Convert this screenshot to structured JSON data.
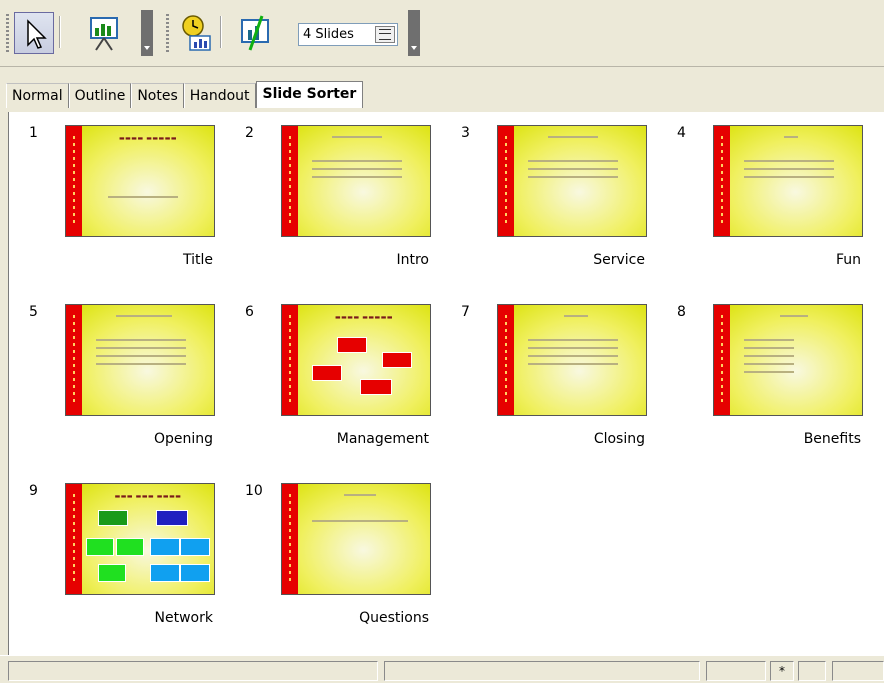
{
  "toolbar": {
    "buttons": [
      {
        "name": "select-arrow-icon"
      },
      {
        "name": "slide-show-icon"
      },
      {
        "name": "rehearse-timings-icon"
      },
      {
        "name": "show-hide-slide-icon"
      }
    ],
    "slides_per_row_value": "4 Slides"
  },
  "tabs": [
    {
      "label": "Normal"
    },
    {
      "label": "Outline"
    },
    {
      "label": "Notes"
    },
    {
      "label": "Handout"
    },
    {
      "label": "Slide Sorter",
      "selected": true
    }
  ],
  "slides": [
    {
      "number": "1",
      "name": "Title"
    },
    {
      "number": "2",
      "name": "Intro"
    },
    {
      "number": "3",
      "name": "Service"
    },
    {
      "number": "4",
      "name": "Fun"
    },
    {
      "number": "5",
      "name": "Opening"
    },
    {
      "number": "6",
      "name": "Management"
    },
    {
      "number": "7",
      "name": "Closing"
    },
    {
      "number": "8",
      "name": "Benefits"
    },
    {
      "number": "9",
      "name": "Network"
    },
    {
      "number": "10",
      "name": "Questions"
    }
  ],
  "statusbar": {
    "modified_indicator": "*"
  },
  "colors": {
    "slide_accent": "#e60000",
    "slide_background": "#f0f060"
  }
}
